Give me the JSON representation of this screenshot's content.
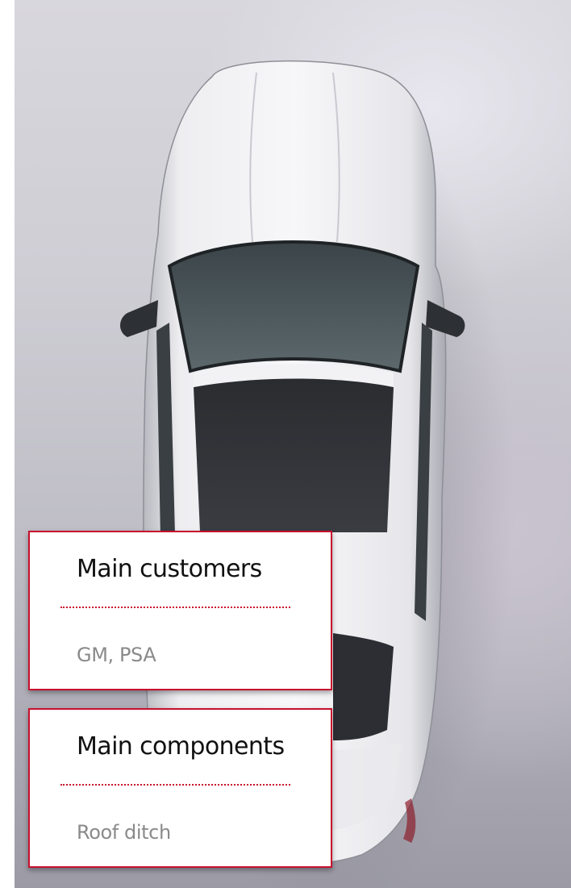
{
  "cards": [
    {
      "title": "Main customers",
      "value": "GM, PSA"
    },
    {
      "title": "Main components",
      "value": "Roof ditch"
    }
  ],
  "colors": {
    "accent": "#c8102e",
    "title_text": "#111111",
    "value_text": "#8a8a8a"
  },
  "image": {
    "subject_icon": "car-top-view"
  }
}
